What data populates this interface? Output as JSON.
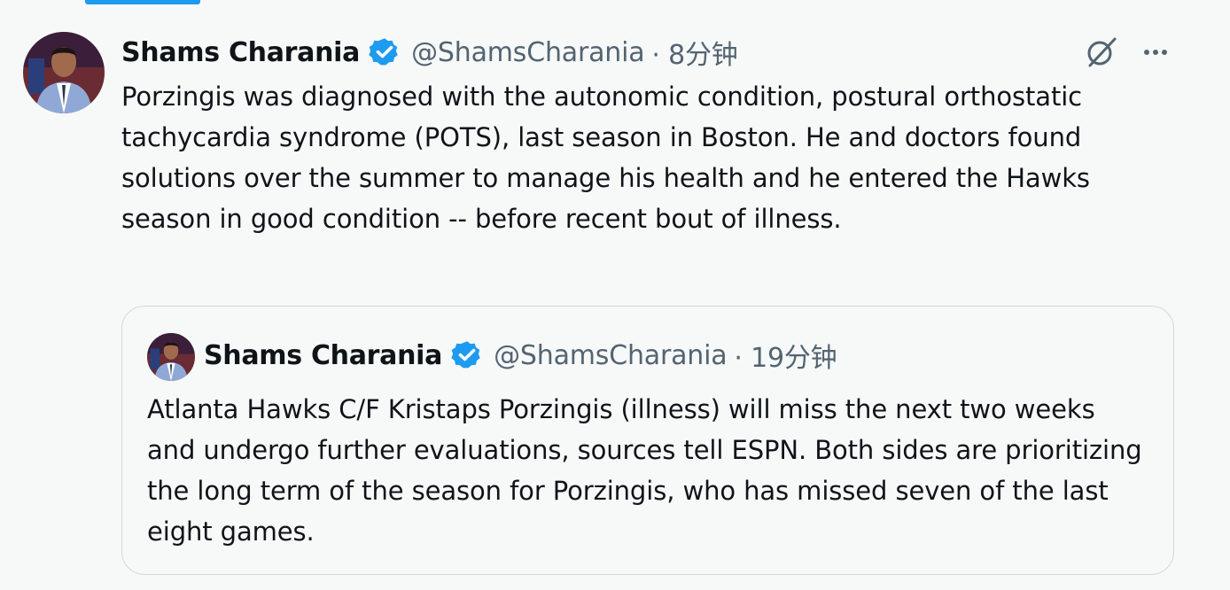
{
  "tweet": {
    "author_name": "Shams Charania",
    "handle": "@ShamsCharania",
    "time": "· 8分钟",
    "text": "Porzingis was diagnosed with the autonomic condition, postural orthostatic tachycardia syndrome (POTS), last season in Boston. He and doctors found solutions over the summer to manage his health and he entered the Hawks season in good condition -- before recent bout of illness.",
    "icons": {
      "verified": "verified-badge-icon",
      "grok": "grok-icon",
      "more": "more-icon"
    }
  },
  "quote": {
    "author_name": "Shams Charania",
    "handle": "@ShamsCharania",
    "time": "· 19分钟",
    "text": "Atlanta Hawks C/F Kristaps Porzingis (illness) will miss the next two weeks and undergo further evaluations, sources tell ESPN. Both sides are prioritizing the long term of the season for Porzingis, who has missed seven of the last eight games."
  },
  "colors": {
    "accent": "#1d9bf0",
    "secondary_text": "#536471",
    "primary_text": "#0f1419",
    "border": "#cfd9de",
    "background": "#f7f9f9"
  }
}
